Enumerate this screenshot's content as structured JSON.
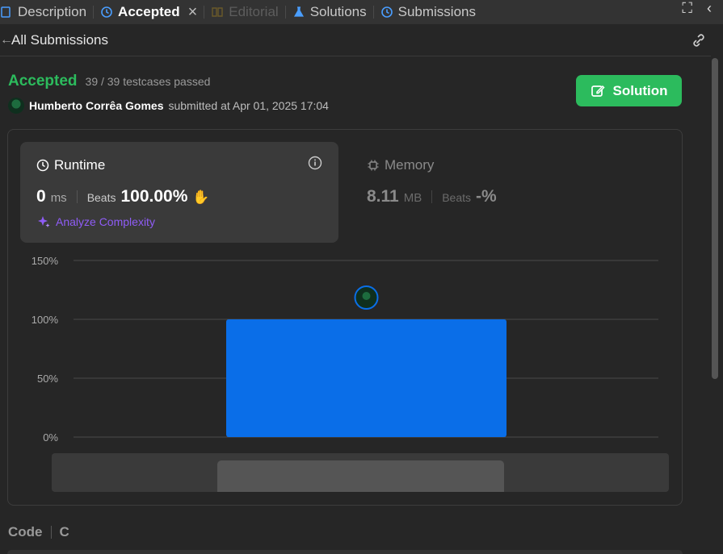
{
  "tabs": [
    {
      "label": "Description",
      "icon": "description-icon",
      "state": "normal"
    },
    {
      "label": "Accepted",
      "icon": "history-icon",
      "state": "active"
    },
    {
      "label": "Editorial",
      "icon": "book-icon",
      "state": "disabled"
    },
    {
      "label": "Solutions",
      "icon": "flask-icon",
      "state": "normal"
    },
    {
      "label": "Submissions",
      "icon": "history-icon",
      "state": "normal"
    }
  ],
  "subheader": {
    "title": "All Submissions"
  },
  "result": {
    "status": "Accepted",
    "cases": "39 / 39 testcases passed",
    "author": "Humberto Corrêa Gomes",
    "submitted": "submitted at Apr 01, 2025 17:04"
  },
  "solution_button": {
    "label": "Solution"
  },
  "runtime": {
    "title": "Runtime",
    "value": "0",
    "unit": "ms",
    "beats_label": "Beats",
    "beats_value": "100.00%",
    "analyze": "Analyze Complexity"
  },
  "memory": {
    "title": "Memory",
    "value": "8.11",
    "unit": "MB",
    "beats_label": "Beats",
    "beats_value": "-%"
  },
  "chart_data": {
    "type": "bar",
    "categories": [
      ""
    ],
    "values": [
      100
    ],
    "ylim": [
      0,
      150
    ],
    "yticks": [
      "0%",
      "50%",
      "100%",
      "150%"
    ],
    "tick_values": [
      0,
      50,
      100,
      150
    ],
    "grid": true,
    "bar_color": "#0a6ee8"
  },
  "code": {
    "label": "Code",
    "language": "C"
  },
  "colors": {
    "accent_green": "#2cbb5d",
    "bar_blue": "#0a6ee8",
    "analyze_purple": "#8f5cf6"
  }
}
